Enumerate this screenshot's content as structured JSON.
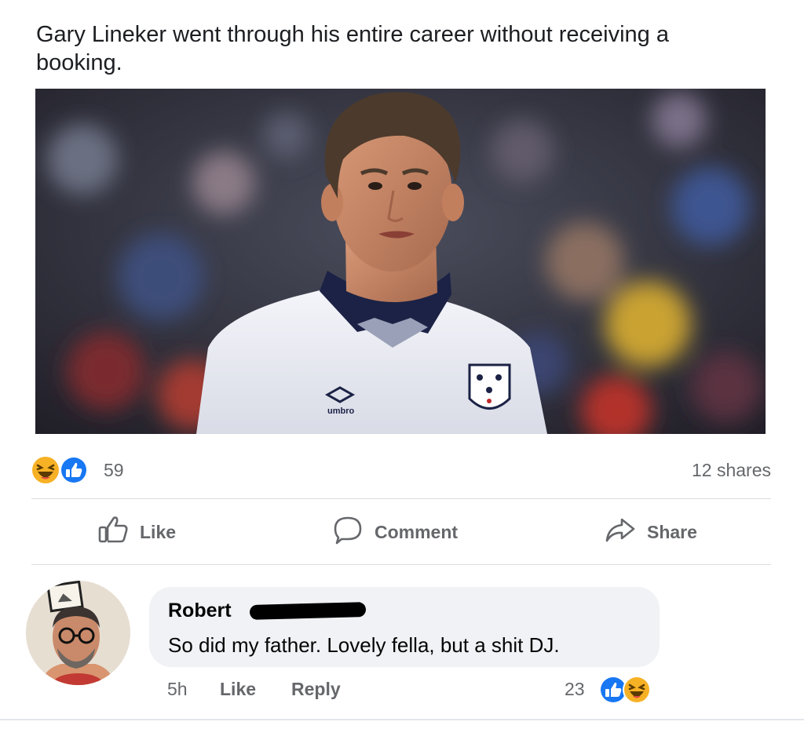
{
  "post": {
    "text": "Gary Lineker went through his entire career without receiving a booking.",
    "photo_kit_brand": "umbro"
  },
  "reactions": {
    "count": "59",
    "types": [
      "haha-icon",
      "like-icon"
    ],
    "shares": "12 shares"
  },
  "actions": {
    "like": "Like",
    "comment": "Comment",
    "share": "Share"
  },
  "comment": {
    "author": "Robert",
    "text": "So did my father. Lovely fella, but a shit DJ.",
    "time": "5h",
    "like_label": "Like",
    "reply_label": "Reply",
    "reaction_count": "23",
    "reaction_types": [
      "like-icon",
      "haha-icon"
    ]
  },
  "colors": {
    "facebook_blue": "#1877f2",
    "haha_yellow": "#f7b125",
    "secondary_text": "#65676b",
    "bubble_bg": "#f0f2f5"
  }
}
